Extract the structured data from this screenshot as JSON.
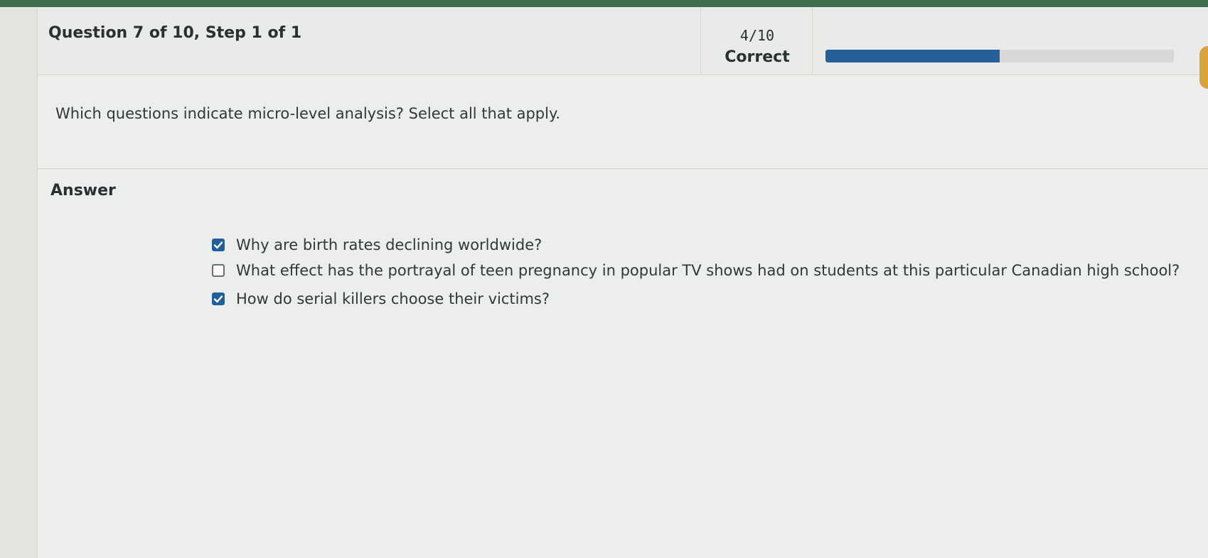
{
  "header": {
    "question_title": "Question 7 of 10, Step 1 of 1",
    "score_value": "4/10",
    "score_label": "Correct",
    "progress": 0.5
  },
  "prompt": {
    "text": "Which questions indicate micro-level analysis? Select all that apply."
  },
  "answer": {
    "label": "Answer",
    "options": [
      {
        "label": "Why are birth rates declining worldwide?",
        "checked": true
      },
      {
        "label": "What effect has the portrayal of teen pregnancy in popular TV shows had on students at this particular Canadian high school?",
        "checked": false
      },
      {
        "label": "How do serial killers choose their victims?",
        "checked": true
      }
    ]
  },
  "colors": {
    "accent": "#24609a",
    "top_bar": "#3f6f4c",
    "side_tab": "#d9a23b"
  }
}
